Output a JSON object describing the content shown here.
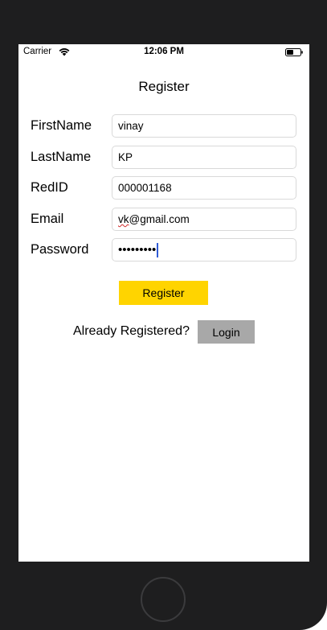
{
  "status_bar": {
    "carrier": "Carrier",
    "time": "12:06 PM",
    "wifi_icon": "wifi-icon",
    "battery_icon": "battery-icon"
  },
  "title": "Register",
  "form": {
    "firstname": {
      "label": "FirstName",
      "value": "vinay"
    },
    "lastname": {
      "label": "LastName",
      "value": "KP"
    },
    "redid": {
      "label": "RedID",
      "value": "000001168"
    },
    "email": {
      "label": "Email",
      "value_prefix": "vk",
      "value_suffix": "@gmail.com"
    },
    "password": {
      "label": "Password",
      "masked": "•••••••••"
    }
  },
  "register_button": "Register",
  "already_registered": "Already Registered?",
  "login_button": "Login",
  "colors": {
    "register_button": "#ffd400",
    "login_button": "#a8a8a8",
    "device_frame": "#1e1e1f",
    "cursor": "#2f5bd6"
  }
}
